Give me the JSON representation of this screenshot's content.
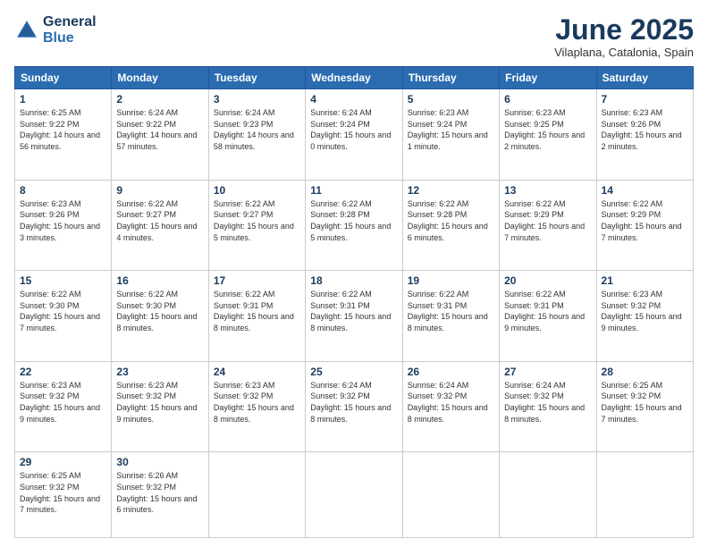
{
  "header": {
    "logo_line1": "General",
    "logo_line2": "Blue",
    "month_title": "June 2025",
    "subtitle": "Vilaplana, Catalonia, Spain"
  },
  "days_of_week": [
    "Sunday",
    "Monday",
    "Tuesday",
    "Wednesday",
    "Thursday",
    "Friday",
    "Saturday"
  ],
  "weeks": [
    [
      {
        "day": "1",
        "sunrise": "6:25 AM",
        "sunset": "9:22 PM",
        "daylight": "14 hours and 56 minutes."
      },
      {
        "day": "2",
        "sunrise": "6:24 AM",
        "sunset": "9:22 PM",
        "daylight": "14 hours and 57 minutes."
      },
      {
        "day": "3",
        "sunrise": "6:24 AM",
        "sunset": "9:23 PM",
        "daylight": "14 hours and 58 minutes."
      },
      {
        "day": "4",
        "sunrise": "6:24 AM",
        "sunset": "9:24 PM",
        "daylight": "15 hours and 0 minutes."
      },
      {
        "day": "5",
        "sunrise": "6:23 AM",
        "sunset": "9:24 PM",
        "daylight": "15 hours and 1 minute."
      },
      {
        "day": "6",
        "sunrise": "6:23 AM",
        "sunset": "9:25 PM",
        "daylight": "15 hours and 2 minutes."
      },
      {
        "day": "7",
        "sunrise": "6:23 AM",
        "sunset": "9:26 PM",
        "daylight": "15 hours and 2 minutes."
      }
    ],
    [
      {
        "day": "8",
        "sunrise": "6:23 AM",
        "sunset": "9:26 PM",
        "daylight": "15 hours and 3 minutes."
      },
      {
        "day": "9",
        "sunrise": "6:22 AM",
        "sunset": "9:27 PM",
        "daylight": "15 hours and 4 minutes."
      },
      {
        "day": "10",
        "sunrise": "6:22 AM",
        "sunset": "9:27 PM",
        "daylight": "15 hours and 5 minutes."
      },
      {
        "day": "11",
        "sunrise": "6:22 AM",
        "sunset": "9:28 PM",
        "daylight": "15 hours and 5 minutes."
      },
      {
        "day": "12",
        "sunrise": "6:22 AM",
        "sunset": "9:28 PM",
        "daylight": "15 hours and 6 minutes."
      },
      {
        "day": "13",
        "sunrise": "6:22 AM",
        "sunset": "9:29 PM",
        "daylight": "15 hours and 7 minutes."
      },
      {
        "day": "14",
        "sunrise": "6:22 AM",
        "sunset": "9:29 PM",
        "daylight": "15 hours and 7 minutes."
      }
    ],
    [
      {
        "day": "15",
        "sunrise": "6:22 AM",
        "sunset": "9:30 PM",
        "daylight": "15 hours and 7 minutes."
      },
      {
        "day": "16",
        "sunrise": "6:22 AM",
        "sunset": "9:30 PM",
        "daylight": "15 hours and 8 minutes."
      },
      {
        "day": "17",
        "sunrise": "6:22 AM",
        "sunset": "9:31 PM",
        "daylight": "15 hours and 8 minutes."
      },
      {
        "day": "18",
        "sunrise": "6:22 AM",
        "sunset": "9:31 PM",
        "daylight": "15 hours and 8 minutes."
      },
      {
        "day": "19",
        "sunrise": "6:22 AM",
        "sunset": "9:31 PM",
        "daylight": "15 hours and 8 minutes."
      },
      {
        "day": "20",
        "sunrise": "6:22 AM",
        "sunset": "9:31 PM",
        "daylight": "15 hours and 9 minutes."
      },
      {
        "day": "21",
        "sunrise": "6:23 AM",
        "sunset": "9:32 PM",
        "daylight": "15 hours and 9 minutes."
      }
    ],
    [
      {
        "day": "22",
        "sunrise": "6:23 AM",
        "sunset": "9:32 PM",
        "daylight": "15 hours and 9 minutes."
      },
      {
        "day": "23",
        "sunrise": "6:23 AM",
        "sunset": "9:32 PM",
        "daylight": "15 hours and 9 minutes."
      },
      {
        "day": "24",
        "sunrise": "6:23 AM",
        "sunset": "9:32 PM",
        "daylight": "15 hours and 8 minutes."
      },
      {
        "day": "25",
        "sunrise": "6:24 AM",
        "sunset": "9:32 PM",
        "daylight": "15 hours and 8 minutes."
      },
      {
        "day": "26",
        "sunrise": "6:24 AM",
        "sunset": "9:32 PM",
        "daylight": "15 hours and 8 minutes."
      },
      {
        "day": "27",
        "sunrise": "6:24 AM",
        "sunset": "9:32 PM",
        "daylight": "15 hours and 8 minutes."
      },
      {
        "day": "28",
        "sunrise": "6:25 AM",
        "sunset": "9:32 PM",
        "daylight": "15 hours and 7 minutes."
      }
    ],
    [
      {
        "day": "29",
        "sunrise": "6:25 AM",
        "sunset": "9:32 PM",
        "daylight": "15 hours and 7 minutes."
      },
      {
        "day": "30",
        "sunrise": "6:26 AM",
        "sunset": "9:32 PM",
        "daylight": "15 hours and 6 minutes."
      },
      null,
      null,
      null,
      null,
      null
    ]
  ]
}
